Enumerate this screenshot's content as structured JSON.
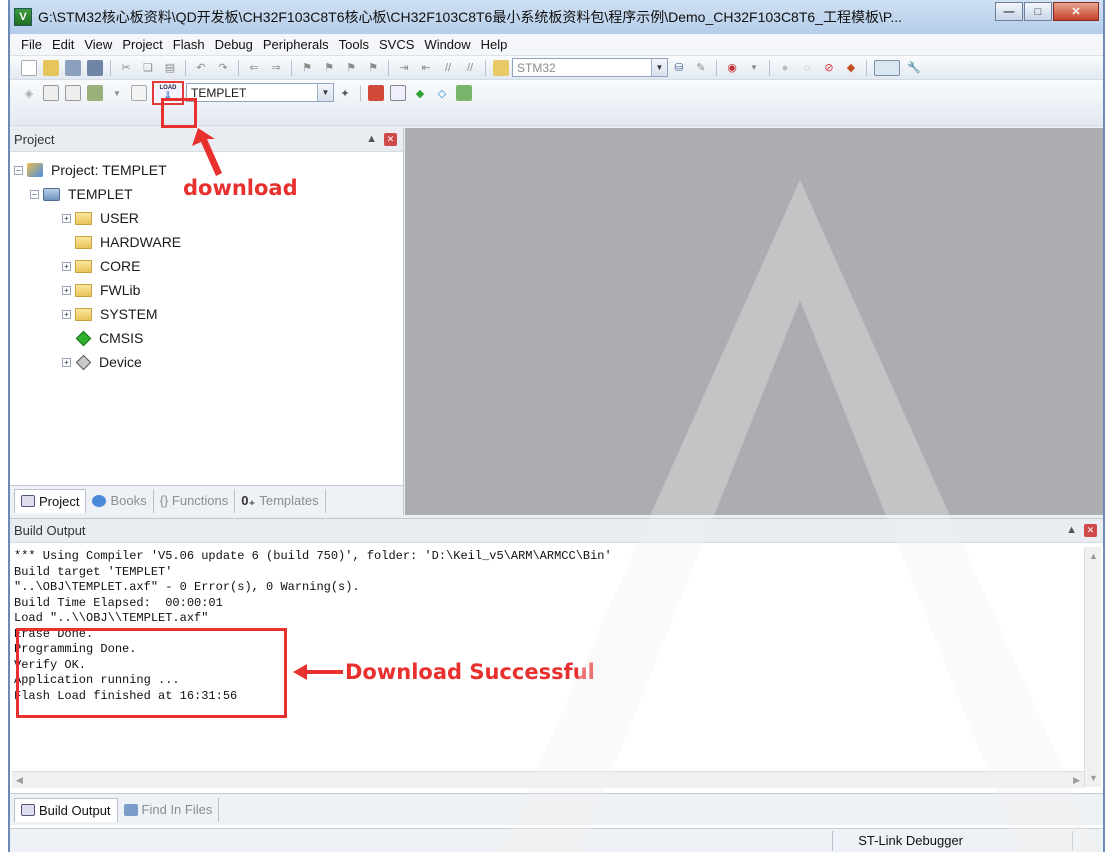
{
  "window": {
    "title": "G:\\STM32核心板资料\\QD开发板\\CH32F103C8T6核心板\\CH32F103C8T6最小系统板资料包\\程序示例\\Demo_CH32F103C8T6_工程模板\\P...",
    "app_icon_label": "V"
  },
  "menu": [
    "File",
    "Edit",
    "View",
    "Project",
    "Flash",
    "Debug",
    "Peripherals",
    "Tools",
    "SVCS",
    "Window",
    "Help"
  ],
  "toolbar1": {
    "device_combo": "STM32"
  },
  "toolbar2": {
    "load_label": "LOAD",
    "target_combo": "TEMPLET"
  },
  "project_panel": {
    "title": "Project",
    "tree": [
      {
        "label": "Project: TEMPLET",
        "level": 0,
        "expander": "-",
        "icon": "project-icon"
      },
      {
        "label": "TEMPLET",
        "level": 1,
        "expander": "-",
        "icon": "target-icon"
      },
      {
        "label": "USER",
        "level": 2,
        "expander": "+",
        "icon": "folder-icon"
      },
      {
        "label": "HARDWARE",
        "level": 2,
        "expander": "",
        "icon": "folder-icon"
      },
      {
        "label": "CORE",
        "level": 2,
        "expander": "+",
        "icon": "folder-icon"
      },
      {
        "label": "FWLib",
        "level": 2,
        "expander": "+",
        "icon": "folder-icon"
      },
      {
        "label": "SYSTEM",
        "level": 2,
        "expander": "+",
        "icon": "folder-icon"
      },
      {
        "label": "CMSIS",
        "level": 2,
        "expander": "",
        "icon": "green-diamond-icon"
      },
      {
        "label": "Device",
        "level": 2,
        "expander": "+",
        "icon": "grey-diamond-icon"
      }
    ],
    "tabs": [
      "Project",
      "Books",
      "{} Functions",
      "Templates"
    ]
  },
  "build_output": {
    "title": "Build Output",
    "lines": [
      "*** Using Compiler 'V5.06 update 6 (build 750)', folder: 'D:\\Keil_v5\\ARM\\ARMCC\\Bin'",
      "Build target 'TEMPLET'",
      "\"..\\OBJ\\TEMPLET.axf\" - 0 Error(s), 0 Warning(s).",
      "Build Time Elapsed:  00:00:01",
      "Load \"..\\\\OBJ\\\\TEMPLET.axf\"",
      "Erase Done.",
      "Programming Done.",
      "Verify OK.",
      "Application running ...",
      "Flash Load finished at 16:31:56"
    ],
    "tabs": [
      "Build Output",
      "Find In Files"
    ]
  },
  "status": {
    "debugger": "ST-Link Debugger"
  },
  "annotations": {
    "download": "download",
    "download_successful": "Download Successful"
  },
  "colors": {
    "annotation_red": "#e8302f",
    "editor_bg": "#abadb0",
    "title_bar": "#b5cde9"
  }
}
